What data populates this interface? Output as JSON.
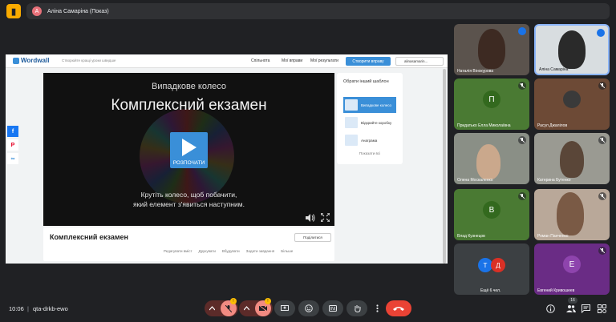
{
  "presenting_chip": {
    "avatar_letter": "А",
    "text": "Аліна Самаріна (Показ)"
  },
  "wordwall": {
    "logo": "Wordwall",
    "tagline": "Створюйте кращі уроки швидше",
    "nav": {
      "community": "Спільнота",
      "my_activities": "Мої вправи",
      "my_results": "Мої результати"
    },
    "create_button": "Створити вправу",
    "user": "alinasamarin...",
    "activity": {
      "template_name": "Випадкове колесо",
      "title": "Комплексний екзамен",
      "start_button": "РОЗПОЧАТИ",
      "hint_line1": "Крутіть колесо, щоб побачити,",
      "hint_line2": "який елемент з'явиться наступним."
    },
    "template_panel": {
      "heading": "Обрати інший шаблон",
      "items": [
        "Випадкове колесо",
        "Відкрийте коробку",
        "Анаграма"
      ],
      "more": "Показати всі"
    },
    "info": {
      "title": "Комплексний екзамен",
      "share": "Поділитися",
      "links": [
        "Редагувати вміст",
        "Друкувати",
        "Вбудувати",
        "Задати завдання",
        "Більше"
      ]
    }
  },
  "participants": [
    {
      "name": "Наталія Вінокурова",
      "type": "video",
      "muted": false,
      "speaking": true
    },
    {
      "name": "Аліна Самаріна",
      "type": "video",
      "muted": false,
      "speaking": true
    },
    {
      "name": "Придатько Елла Миколаївна",
      "type": "avatar",
      "letter": "П",
      "color": "#33691e",
      "muted": true
    },
    {
      "name": "Расул Джалілов",
      "type": "avatar-photo",
      "muted": true
    },
    {
      "name": "Олена Москаленко",
      "type": "video",
      "muted": true
    },
    {
      "name": "Катерина Бутенко",
      "type": "video",
      "muted": true
    },
    {
      "name": "Влад Кузнецов",
      "type": "avatar",
      "letter": "В",
      "color": "#33691e",
      "muted": true
    },
    {
      "name": "Роман Панченко",
      "type": "video",
      "muted": true
    },
    {
      "name": "Ещё 6 чел.",
      "type": "group",
      "letters": [
        "Т",
        "Д"
      ]
    },
    {
      "name": "Евгений Кривошеев",
      "type": "avatar",
      "letter": "Е",
      "color": "#7b1fa2",
      "muted": true
    }
  ],
  "bottom": {
    "time": "10:06",
    "separator": "|",
    "meeting_code": "qta-drkb-ewo",
    "mic_badge": "!",
    "cam_badge": "!",
    "people_count": "16"
  },
  "colors": {
    "accent": "#3a8fd8",
    "danger": "#ea4335",
    "muted_red": "#f28b82"
  }
}
